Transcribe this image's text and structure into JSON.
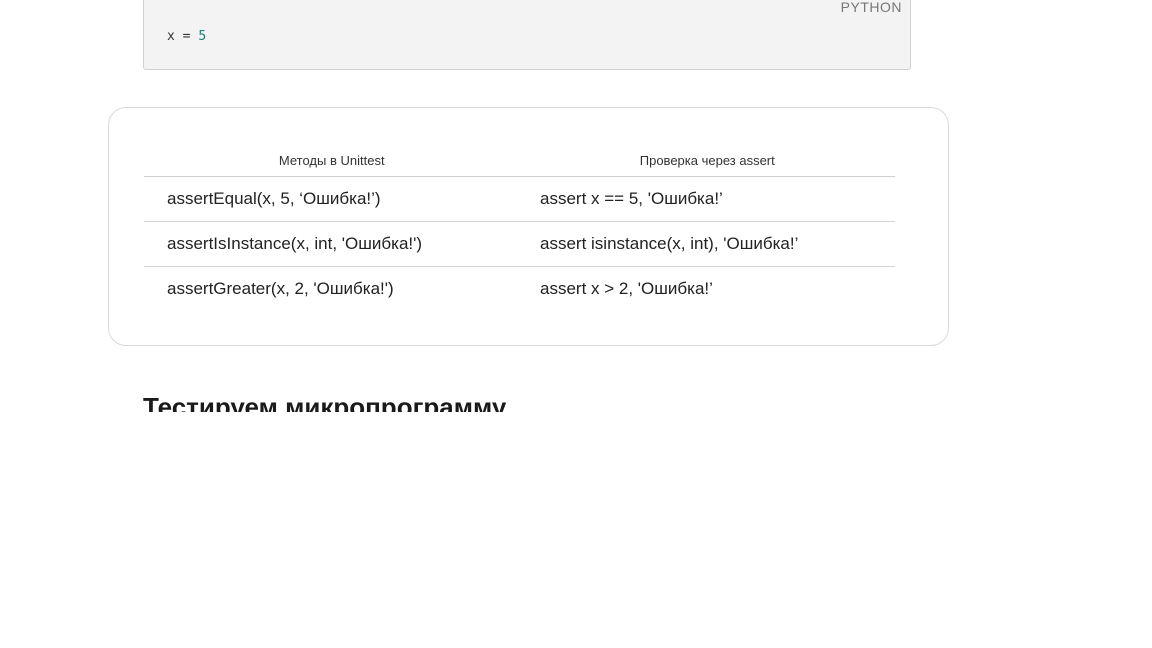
{
  "code_block": {
    "language": "PYTHON",
    "code_var": "x = ",
    "code_num": "5"
  },
  "table": {
    "headers": [
      "Методы в Unittest",
      "Проверка через assert"
    ],
    "rows": [
      [
        "assertEqual(x, 5, ‘Ошибка!’)",
        "assert x == 5, 'Ошибка!’"
      ],
      [
        "assertIsInstance(x, int, 'Ошибка!')",
        "assert isinstance(x, int), 'Ошибка!’"
      ],
      [
        "assertGreater(x, 2, 'Ошибка!')",
        "assert x > 2, 'Ошибка!’"
      ]
    ]
  },
  "section": {
    "heading": "Тестируем микропрограмму"
  }
}
